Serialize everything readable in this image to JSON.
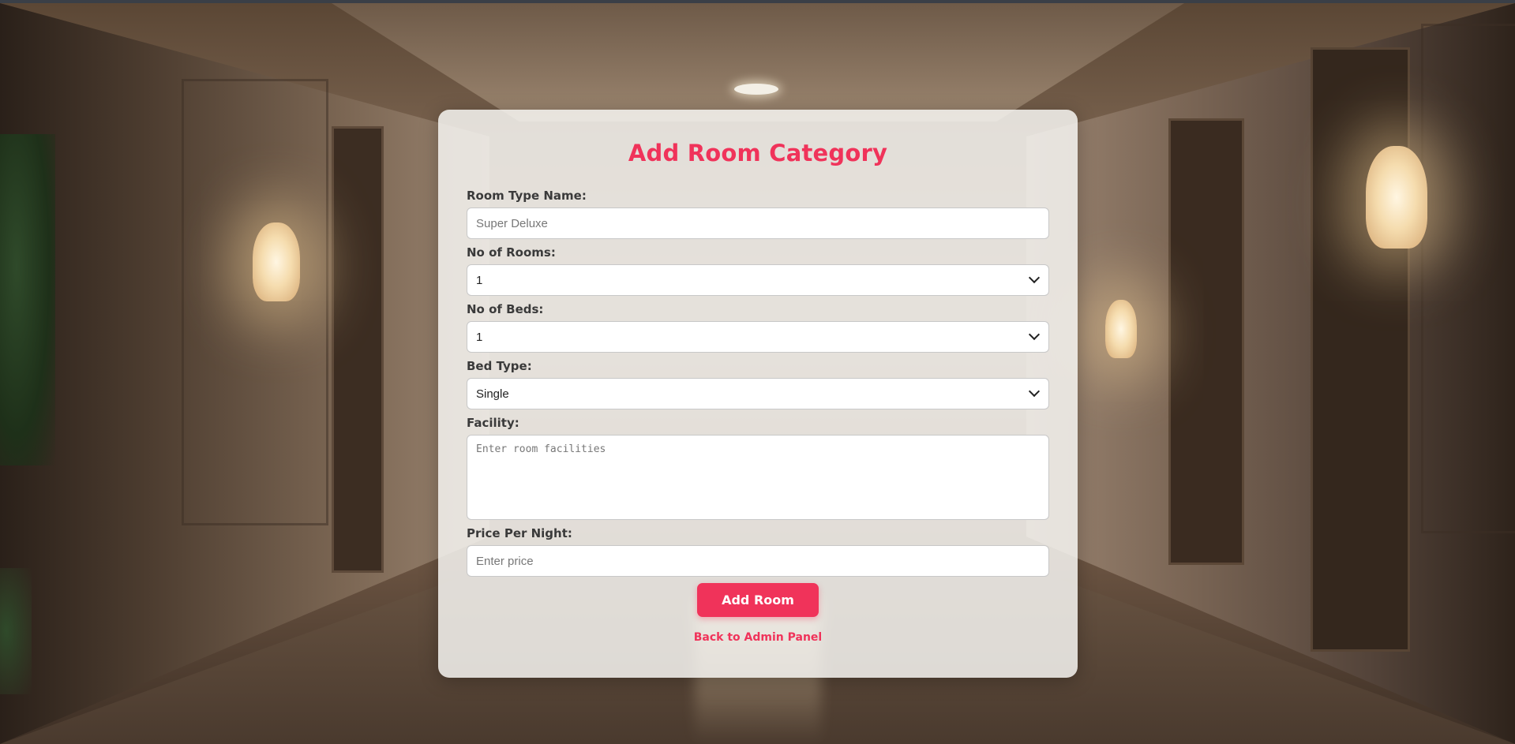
{
  "page": {
    "title": "Add Room Category",
    "accent_color": "#f0335a"
  },
  "form": {
    "room_type": {
      "label": "Room Type Name:",
      "value": "",
      "placeholder": "Super Deluxe"
    },
    "no_of_rooms": {
      "label": "No of Rooms:",
      "selected": "1"
    },
    "no_of_beds": {
      "label": "No of Beds:",
      "selected": "1"
    },
    "bed_type": {
      "label": "Bed Type:",
      "selected": "Single"
    },
    "facility": {
      "label": "Facility:",
      "value": "",
      "placeholder": "Enter room facilities"
    },
    "price": {
      "label": "Price Per Night:",
      "value": "",
      "placeholder": "Enter price"
    },
    "submit_label": "Add Room",
    "back_link_label": "Back to Admin Panel"
  },
  "icons": {
    "select_arrow": "chevron-down-icon"
  }
}
